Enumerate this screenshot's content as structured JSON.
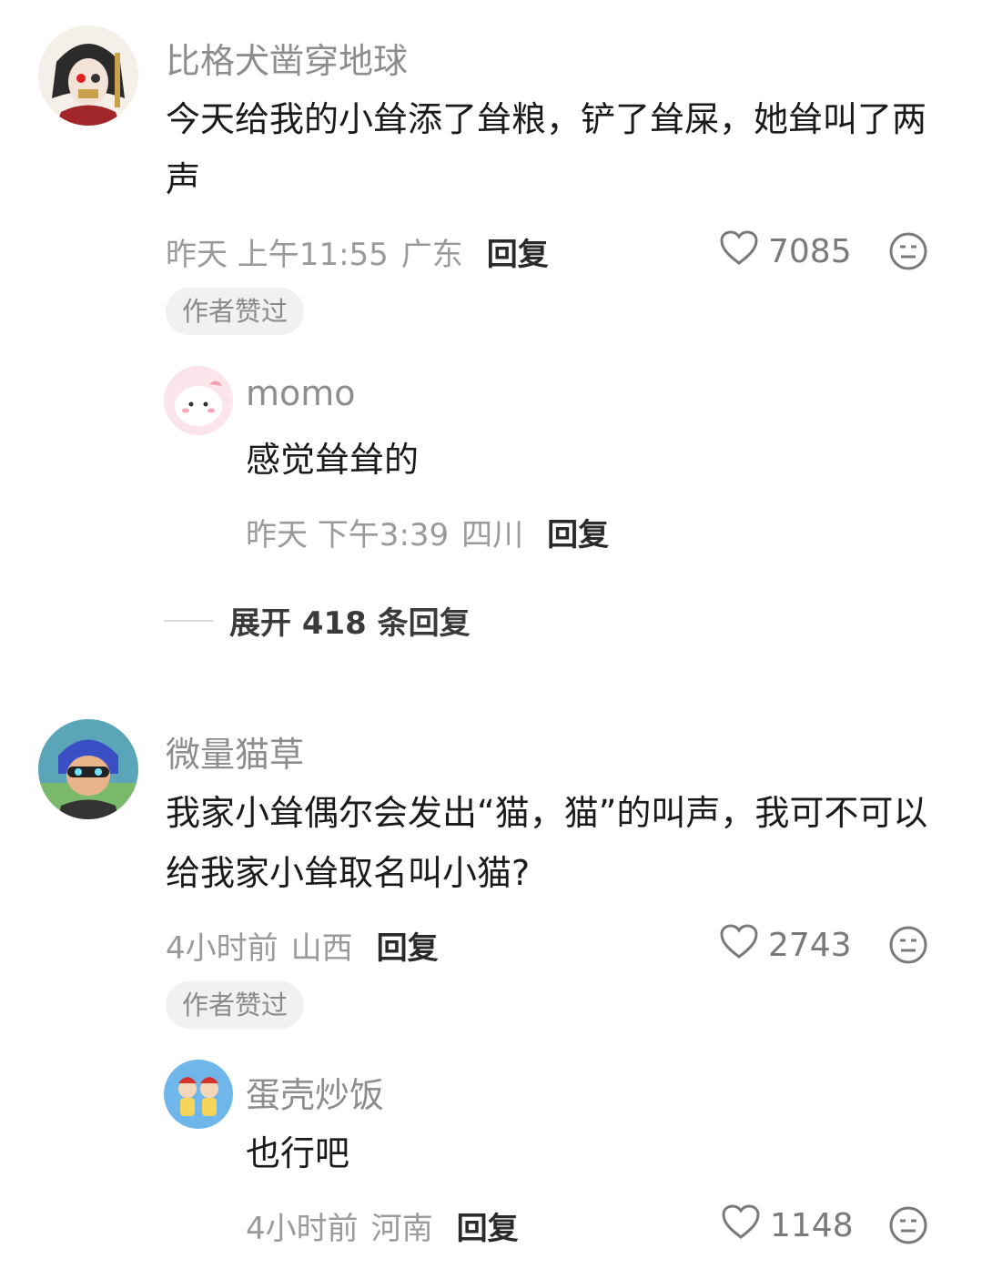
{
  "comments": [
    {
      "username": "比格犬凿穿地球",
      "text": "今天给我的小耸添了耸粮，铲了耸屎，她耸叫了两声",
      "time": "昨天 上午11:55",
      "location": "广东",
      "reply_label": "回复",
      "likes": "7085",
      "badge": "作者赞过",
      "sub_reply": {
        "username": "momo",
        "text": "感觉耸耸的",
        "time": "昨天 下午3:39",
        "location": "四川",
        "reply_label": "回复"
      },
      "expand_label": "展开 418 条回复"
    },
    {
      "username": "微量猫草",
      "text": "我家小耸偶尔会发出“猫，猫”的叫声，我可不可以给我家小耸取名叫小猫?",
      "time": "4小时前",
      "location": "山西",
      "reply_label": "回复",
      "likes": "2743",
      "badge": "作者赞过",
      "sub_reply": {
        "username": "蛋壳炒饭",
        "text": "也行吧",
        "time": "4小时前",
        "location": "河南",
        "reply_label": "回复",
        "likes": "1148"
      }
    }
  ],
  "icons": {
    "like": "heart-outline-icon",
    "dislike": "meh-face-icon"
  }
}
